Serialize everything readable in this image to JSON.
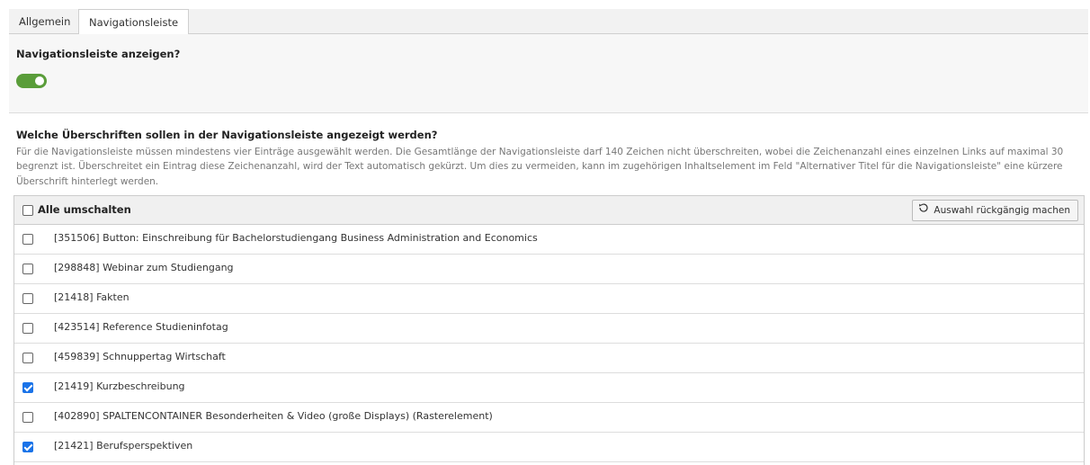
{
  "tabs": [
    {
      "label": "Allgemein"
    },
    {
      "label": "Navigationsleiste"
    }
  ],
  "nav_toggle": {
    "label": "Navigationsleiste anzeigen?",
    "enabled": true
  },
  "question": {
    "title": "Welche Überschriften sollen in der Navigationsleiste angezeigt werden?",
    "description": "Für die Navigationsleiste müssen mindestens vier Einträge ausgewählt werden. Die Gesamtlänge der Navigationsleiste darf 140 Zeichen nicht überschreiten, wobei die Zeichenanzahl eines einzelnen Links auf maximal 30 begrenzt ist. Überschreitet ein Eintrag diese Zeichenanzahl, wird der Text automatisch gekürzt. Um dies zu vermeiden, kann im zugehörigen Inhaltselement im Feld \"Alternativer Titel für die Navigationsleiste\" eine kürzere Überschrift hinterlegt werden."
  },
  "list": {
    "toggle_all_label": "Alle umschalten",
    "undo_label": "Auswahl rückgängig machen",
    "items": [
      {
        "label": "[351506] Button: Einschreibung für Bachelorstudiengang Business Administration and Economics",
        "checked": false
      },
      {
        "label": "[298848] Webinar zum Studiengang",
        "checked": false
      },
      {
        "label": "[21418] Fakten",
        "checked": false
      },
      {
        "label": "[423514] Reference Studieninfotag",
        "checked": false
      },
      {
        "label": "[459839] Schnuppertag Wirtschaft",
        "checked": false
      },
      {
        "label": "[21419] Kurzbeschreibung",
        "checked": true
      },
      {
        "label": "[402890] SPALTENCONTAINER Besonderheiten & Video (große Displays) (Rasterelement)",
        "checked": false
      },
      {
        "label": "[21421] Berufsperspektiven",
        "checked": true
      }
    ]
  }
}
